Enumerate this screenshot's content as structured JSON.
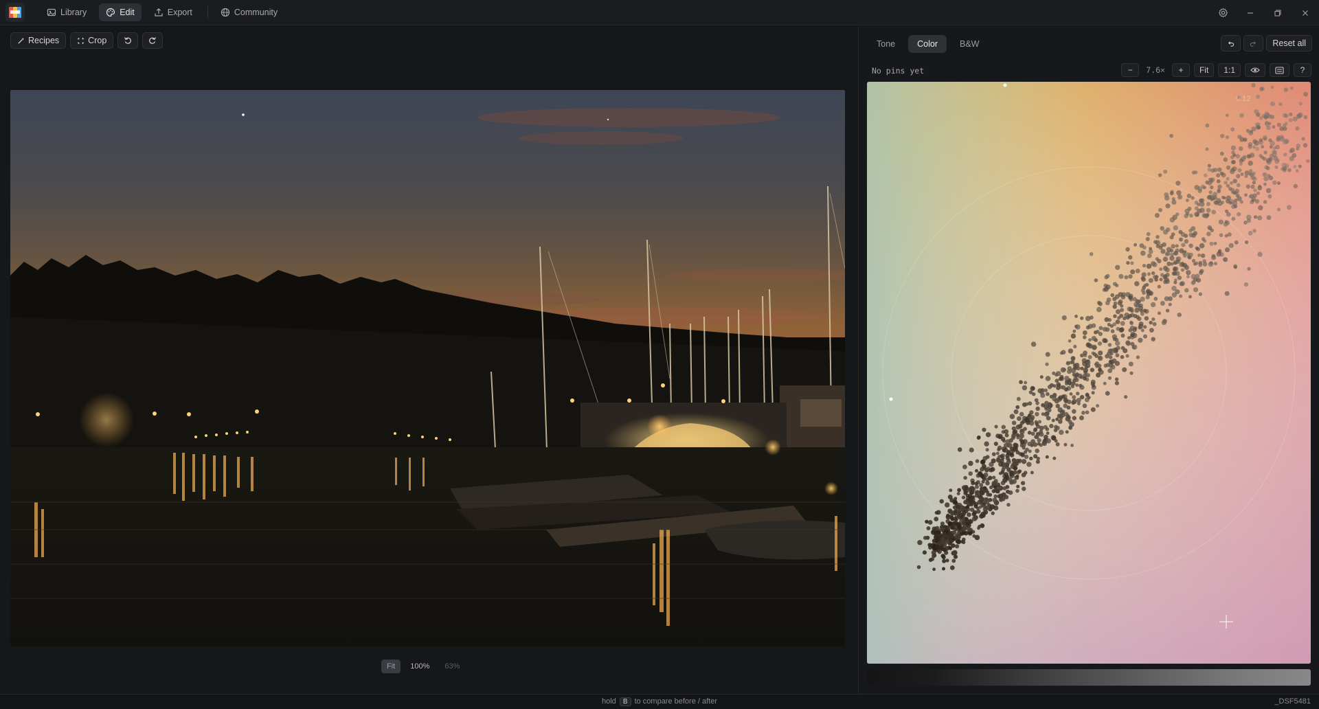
{
  "nav": {
    "items": [
      {
        "label": "Library",
        "icon": "library-icon"
      },
      {
        "label": "Edit",
        "icon": "palette-icon",
        "active": true
      },
      {
        "label": "Export",
        "icon": "export-icon"
      },
      {
        "label": "Community",
        "icon": "globe-icon"
      }
    ]
  },
  "toolbar": {
    "recipes_label": "Recipes",
    "crop_label": "Crop"
  },
  "viewer": {
    "zoom_fit": "Fit",
    "zoom_100": "100%",
    "zoom_current": "63%"
  },
  "panel": {
    "tabs": [
      {
        "label": "Tone"
      },
      {
        "label": "Color",
        "active": true
      },
      {
        "label": "B&W"
      }
    ],
    "reset_all": "Reset all",
    "pins_text": "No pins yet",
    "scope_zoom": "7.6×",
    "fit_label": "Fit",
    "one_to_one": "1:1",
    "help_label": "?",
    "minus_label": "−",
    "plus_label": "+",
    "scope_value": "0.12"
  },
  "status": {
    "hint_before": "hold",
    "hint_key": "B",
    "hint_after": "to compare before / after",
    "filename": "_DSF5481"
  },
  "colors": {
    "accent_bg": "#2f3136",
    "sky_top": "#3d4553",
    "sunset": "#b0663e"
  }
}
